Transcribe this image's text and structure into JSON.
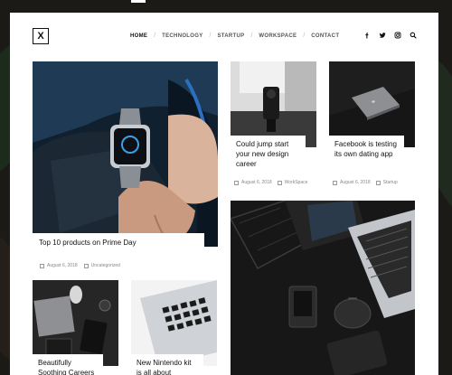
{
  "site": {
    "logo": "X"
  },
  "nav": {
    "items": [
      {
        "label": "HOME",
        "active": true
      },
      {
        "label": "TECHNOLOGY",
        "active": false
      },
      {
        "label": "STARTUP",
        "active": false
      },
      {
        "label": "WORKSPACE",
        "active": false
      },
      {
        "label": "CONTACT",
        "active": false
      }
    ],
    "social_icons": [
      "facebook-icon",
      "twitter-icon",
      "instagram-icon",
      "search-icon"
    ]
  },
  "posts": [
    {
      "title": "Top 10 products on Prime Day",
      "date": "August 6, 2018",
      "category": "Uncategorized"
    },
    {
      "title": "Could jump start your new design career",
      "date": "August 6, 2018",
      "category": "WorkSpace"
    },
    {
      "title": "Facebook is testing its own dating app",
      "date": "August 6, 2018",
      "category": "Startup"
    },
    {
      "title": "Beautifully Soothing Careers",
      "date": "",
      "category": ""
    },
    {
      "title": "New Nintendo kit is all about",
      "date": "",
      "category": ""
    }
  ],
  "colors": {
    "accent": "#111111",
    "page_bg": "#ffffff",
    "backdrop": "#1c1a17"
  }
}
